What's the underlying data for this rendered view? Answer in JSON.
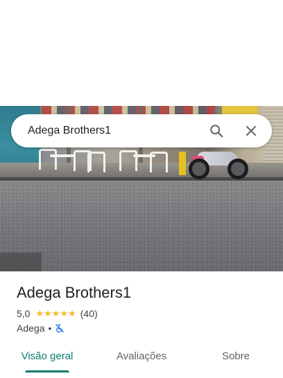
{
  "search": {
    "value": "Adega Brothers1",
    "icons": {
      "search": "search-icon",
      "close": "close-icon"
    }
  },
  "place": {
    "name": "Adega Brothers1",
    "rating": "5,0",
    "stars": 5,
    "reviews": "(40)",
    "category": "Adega",
    "separator": "•",
    "attribute_icon": "no-wheelchair-icon"
  },
  "tabs": [
    {
      "label": "Visão geral",
      "active": true
    },
    {
      "label": "Avaliações",
      "active": false
    },
    {
      "label": "Sobre",
      "active": false
    }
  ],
  "colors": {
    "accent": "#0b7a6e",
    "star": "#f7b928",
    "attribute_icon": "#1a73e8"
  }
}
